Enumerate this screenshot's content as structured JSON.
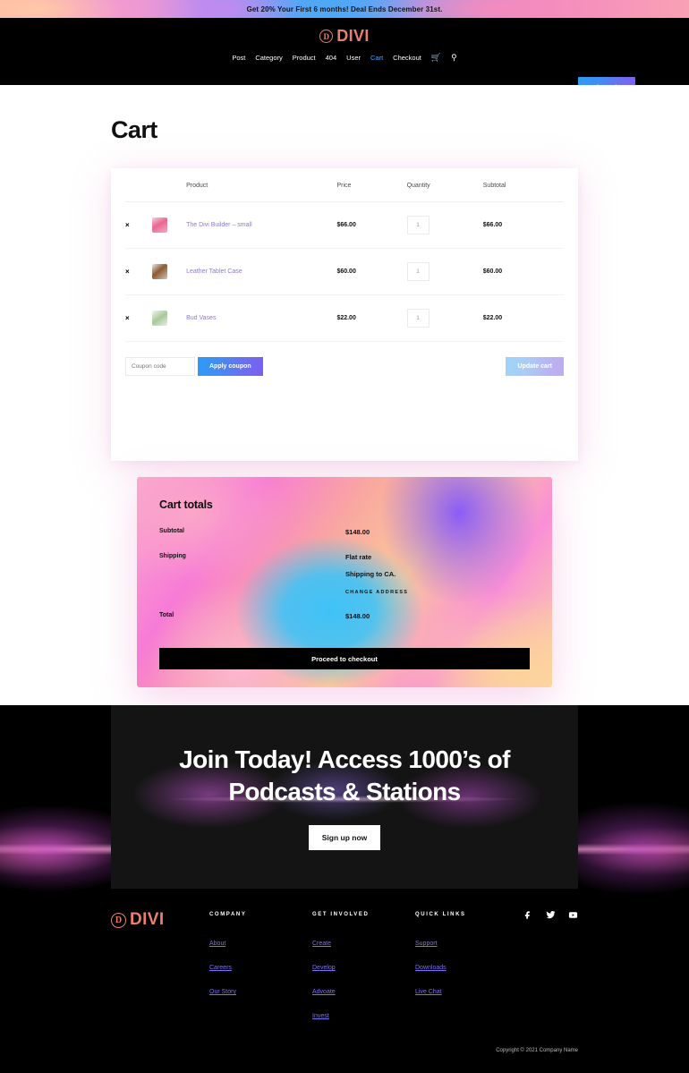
{
  "promo": {
    "text": "Get 20% Your First 6 months! Deal Ends December 31st."
  },
  "brand": {
    "mark": "D",
    "name": "DIVI"
  },
  "nav": {
    "items": [
      {
        "label": "Post",
        "active": false
      },
      {
        "label": "Category",
        "active": false
      },
      {
        "label": "Product",
        "active": false
      },
      {
        "label": "404",
        "active": false
      },
      {
        "label": "User",
        "active": false
      },
      {
        "label": "Cart",
        "active": true
      },
      {
        "label": "Checkout",
        "active": false
      }
    ],
    "cart_icon": "shopping-cart-icon",
    "search_icon": "search-icon",
    "join_label": "Join Today"
  },
  "page": {
    "title": "Cart"
  },
  "cart": {
    "headers": {
      "blank1": "",
      "blank2": "",
      "product": "Product",
      "price": "Price",
      "quantity": "Quantity",
      "subtotal": "Subtotal"
    },
    "remove_symbol": "×",
    "rows": [
      {
        "name": "The Divi Builder – small",
        "price": "$66.00",
        "qty": "1",
        "subtotal": "$66.00",
        "thumb": "divi-builder-thumb"
      },
      {
        "name": "Leather Tablet Case",
        "price": "$60.00",
        "qty": "1",
        "subtotal": "$60.00",
        "thumb": "leather-tablet-case-thumb"
      },
      {
        "name": "Bud Vases",
        "price": "$22.00",
        "qty": "1",
        "subtotal": "$22.00",
        "thumb": "bud-vases-thumb"
      }
    ],
    "coupon_placeholder": "Coupon code",
    "coupon_value": "",
    "apply_label": "Apply coupon",
    "update_label": "Update cart"
  },
  "totals": {
    "title": "Cart totals",
    "subtotal_label": "Subtotal",
    "subtotal_value": "$148.00",
    "shipping_label": "Shipping",
    "shipping_rate": "Flat rate",
    "shipping_to": "Shipping to CA.",
    "change_address": "CHANGE ADDRESS",
    "total_label": "Total",
    "total_value": "$148.00",
    "checkout_label": "Proceed to checkout"
  },
  "cta": {
    "line1": "Join Today! Access 1000’s of",
    "line2": "Podcasts & Stations",
    "button": "Sign up now"
  },
  "footer": {
    "columns": [
      {
        "title": "COMPANY",
        "links": [
          "About",
          "Careers",
          "Our Story"
        ]
      },
      {
        "title": "GET INVOLVED",
        "links": [
          "Create",
          "Develop",
          "Advoate",
          "Invest"
        ]
      },
      {
        "title": "QUICK LINKS",
        "links": [
          "Support",
          "Downloads",
          "Live Chat"
        ]
      }
    ],
    "socials": [
      "facebook-icon",
      "twitter-icon",
      "youtube-icon"
    ],
    "copyright": "Copyright © 2021 Company Name"
  },
  "colors": {
    "brand": "#e8806f",
    "accent_blue": "#3fa9f5",
    "link_purple": "#7f6ff0",
    "product_link": "#8a7bd8"
  }
}
